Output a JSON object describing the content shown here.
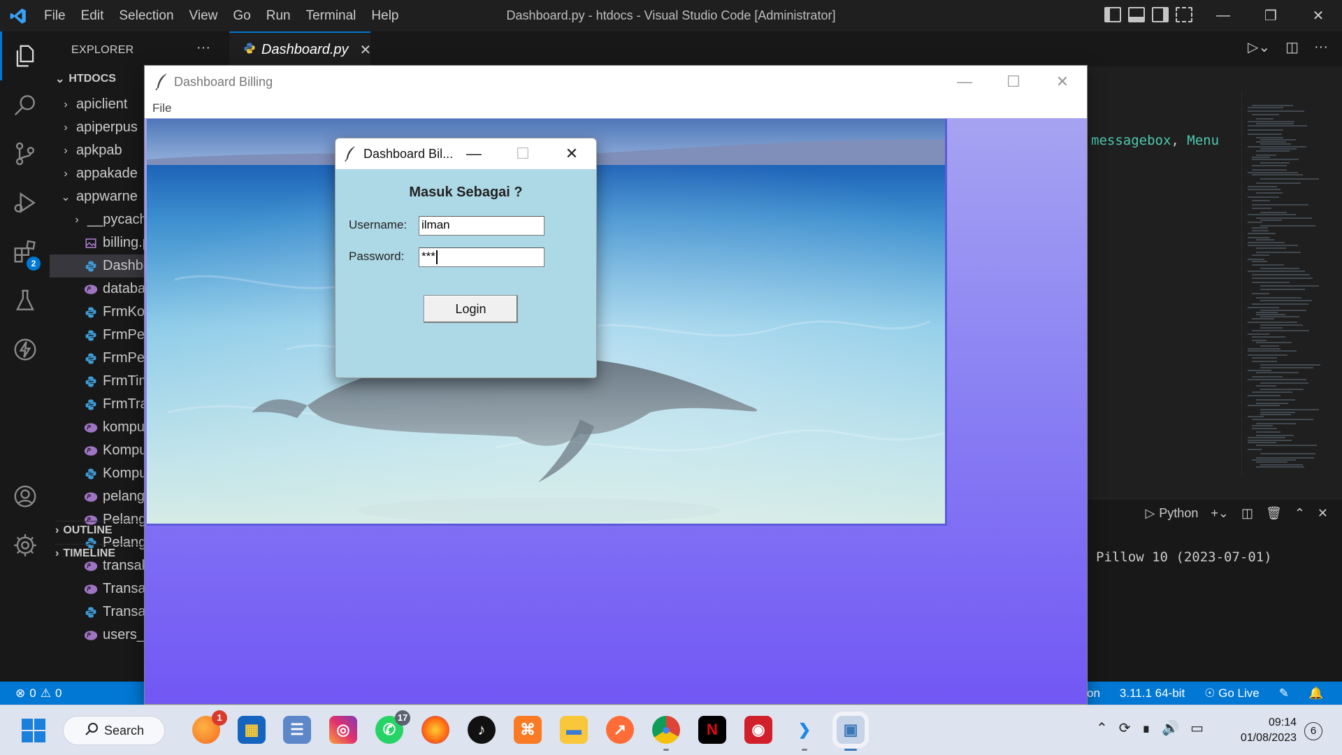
{
  "vscode": {
    "menu": [
      "File",
      "Edit",
      "Selection",
      "View",
      "Go",
      "Run",
      "Terminal",
      "Help"
    ],
    "window_title": "Dashboard.py - htdocs - Visual Studio Code [Administrator]",
    "explorer": {
      "title": "EXPLORER",
      "more": "···",
      "root": "HTDOCS",
      "items": [
        {
          "label": "apiclient",
          "type": "folder"
        },
        {
          "label": "apiperpus",
          "type": "folder"
        },
        {
          "label": "apkpab",
          "type": "folder"
        },
        {
          "label": "appakade",
          "type": "folder"
        },
        {
          "label": "appwarne",
          "type": "folder-open"
        },
        {
          "label": "__pycach",
          "type": "folder"
        },
        {
          "label": "billing.p",
          "type": "image"
        },
        {
          "label": "Dashboa",
          "type": "python"
        },
        {
          "label": "database",
          "type": "php"
        },
        {
          "label": "FrmKom",
          "type": "python"
        },
        {
          "label": "FrmPelar",
          "type": "python"
        },
        {
          "label": "FrmPelar",
          "type": "python"
        },
        {
          "label": "FrmTime",
          "type": "python"
        },
        {
          "label": "FrmTrans",
          "type": "python"
        },
        {
          "label": "kompute",
          "type": "php"
        },
        {
          "label": "Kompute",
          "type": "php"
        },
        {
          "label": "Kompute",
          "type": "python"
        },
        {
          "label": "pelangg",
          "type": "php"
        },
        {
          "label": "Pelangg",
          "type": "php"
        },
        {
          "label": "Pelangg",
          "type": "python"
        },
        {
          "label": "transaks",
          "type": "php"
        },
        {
          "label": "Transaks",
          "type": "php"
        },
        {
          "label": "Transaks",
          "type": "python"
        },
        {
          "label": "users_ar",
          "type": "php"
        }
      ],
      "outline": "OUTLINE",
      "timeline": "TIMELINE"
    },
    "extensions_badge": "2",
    "tab": {
      "label": "Dashboard.py",
      "close": "✕"
    },
    "code_fragment": {
      "names": "messagebox",
      "sep": ", ",
      "menu": "Menu"
    },
    "panel": {
      "shell_label": "Python",
      "terminal_line": "Pillow 10 (2023-07-01)"
    },
    "status": {
      "errors": "0",
      "warnings": "0",
      "language_suffix": "on",
      "interpreter": "3.11.1 64-bit",
      "go_live": "Go Live"
    },
    "colors": {
      "accent": "#0078d4",
      "editor_bg": "#1f1f1f",
      "sidebar_bg": "#181818"
    }
  },
  "tk_window": {
    "title": "Dashboard Billing",
    "menu_file": "File",
    "bg_colors": {
      "top": "#a6a3f2",
      "bottom": "#7257f4"
    }
  },
  "login": {
    "title": "Dashboard Bil...",
    "heading": "Masuk Sebagai ?",
    "username_label": "Username:",
    "username_value": "ilman",
    "password_label": "Password:",
    "password_value": "***",
    "button": "Login",
    "bg_color": "#add8e6"
  },
  "taskbar": {
    "search_label": "Search",
    "apps": [
      {
        "name": "orange-app",
        "badge": "1"
      },
      {
        "name": "microsoft-store"
      },
      {
        "name": "network-app"
      },
      {
        "name": "instagram"
      },
      {
        "name": "whatsapp",
        "badge": "17"
      },
      {
        "name": "firefox"
      },
      {
        "name": "tiktok"
      },
      {
        "name": "xampp"
      },
      {
        "name": "file-explorer"
      },
      {
        "name": "postman"
      },
      {
        "name": "chrome"
      },
      {
        "name": "netflix"
      },
      {
        "name": "screen-recorder"
      },
      {
        "name": "vscode"
      },
      {
        "name": "python-tk"
      }
    ],
    "time": "09:14",
    "date": "01/08/2023",
    "notifications": "6"
  }
}
